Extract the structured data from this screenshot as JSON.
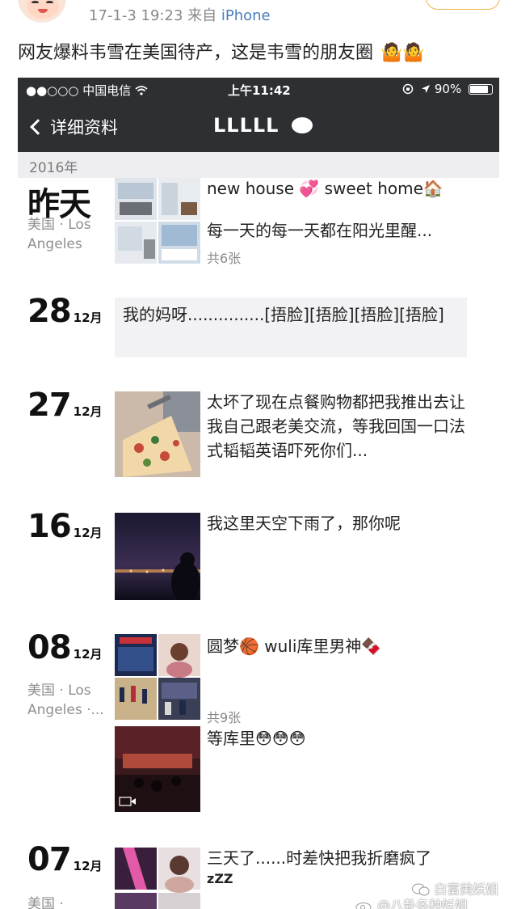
{
  "post": {
    "meta_time": "17-1-3 19:23",
    "meta_from": "来自",
    "meta_source": "iPhone",
    "text": "网友爆料韦雪在美国待产，这是韦雪的朋友圈",
    "emoji": "🤷🤷"
  },
  "statusbar": {
    "carrier": "●●○○○ 中国电信 ",
    "time": "上午11:42",
    "battery_text": "90%",
    "battery_level": 0.9
  },
  "navbar": {
    "back_label": "详细资料",
    "title": "LLLLL"
  },
  "year_label": "2016年",
  "moments": [
    {
      "date_day": "昨天",
      "location": "美国 · Los Angeles",
      "line1": "new house 💞  sweet home🏠",
      "line2": "每一天的每一天都在阳光里醒...",
      "count": "共6张"
    },
    {
      "date_day": "28",
      "date_month": "12月",
      "text": "我的妈呀...............[捂脸][捂脸][捂脸][捂脸]"
    },
    {
      "date_day": "27",
      "date_month": "12月",
      "text": "太坏了现在点餐购物都把我推出去让我自己跟老美交流，等我回国一口法式韬韬英语吓死你们..."
    },
    {
      "date_day": "16",
      "date_month": "12月",
      "text": "我这里天空下雨了，那你呢"
    },
    {
      "date_day": "08",
      "date_month": "12月",
      "location": "美国 · Los Angeles ·...",
      "text": "圆梦🏀 wuli库里男神🍫",
      "count": "共9张",
      "text2": "等库里😳😳😳"
    },
    {
      "date_day": "07",
      "date_month": "12月",
      "location": "美国 ·",
      "text": "三天了......时差快把我折磨疯了",
      "sleep": "zZZ"
    }
  ],
  "watermark": {
    "line1": "白富美妖姐",
    "line2": "@八卦各种妖姐"
  },
  "colors": {
    "wechat_bar": "#2d2f33",
    "link_blue": "#4a7dbd",
    "follow_orange": "#f5b247"
  }
}
